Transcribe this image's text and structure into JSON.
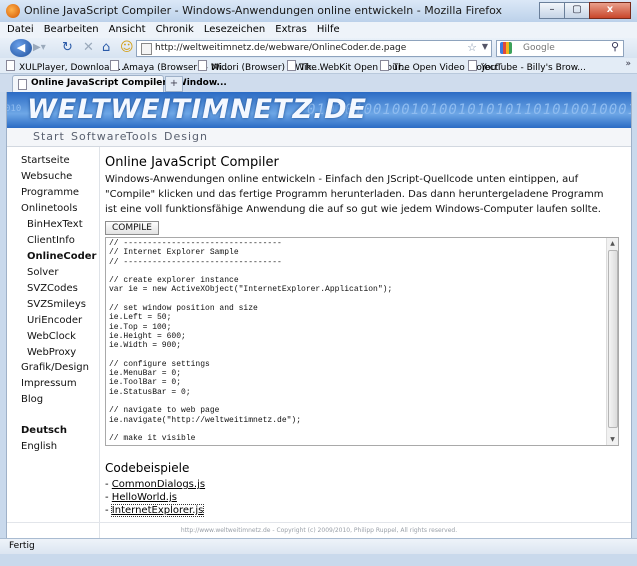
{
  "window": {
    "title": "Online JavaScript Compiler - Windows-Anwendungen online entwickeln - Mozilla Firefox",
    "controls": [
      "–",
      "▢",
      "x"
    ]
  },
  "menu": [
    "Datei",
    "Bearbeiten",
    "Ansicht",
    "Chronik",
    "Lesezeichen",
    "Extras",
    "Hilfe"
  ],
  "navigation": {
    "url": "http://weltweitimnetz.de/webware/OnlineCoder.de.page",
    "search_placeholder": "Google"
  },
  "bookmarks": [
    "XULPlayer, Download ...",
    "Amaya (Browser) – Wi...",
    "Midori (Browser) – Wik...",
    "The WebKit Open Sour...",
    "The Open Video Project",
    "YouTube - Billy's Brow..."
  ],
  "bookmarks_more": "»",
  "tab": {
    "label": "Online JavaScript Compiler - Window...",
    "new_tab": "+"
  },
  "site": {
    "logo": "WELTWEITIMNETZ.DE",
    "binary_pattern": "01010100100101001010101101010010001011100",
    "binary_left": "010",
    "topnav": [
      "Start",
      "Software",
      "Tools",
      "Design"
    ],
    "sidebar": [
      "Startseite",
      "Websuche",
      "Programme",
      "Onlinetools",
      "BinHexText",
      "ClientInfo",
      "OnlineCoder",
      "Solver",
      "SVZCodes",
      "SVZSmileys",
      "UriEncoder",
      "WebClock",
      "WebProxy",
      "Grafik/Design",
      "Impressum",
      "Blog",
      "Deutsch",
      "English"
    ],
    "heading": "Online JavaScript Compiler",
    "description": "Windows-Anwendungen online entwickeln - Einfach den JScript-Quellcode unten eintippen, auf \"Compile\" klicken und das fertige Programm herunterladen. Das dann heruntergeladene Programm ist eine voll funktionsfähige Anwendung die auf so gut wie jedem Windows-Computer laufen sollte.",
    "compile_button": "COMPILE",
    "code": "// ---------------------------------\n// Internet Explorer Sample\n// ---------------------------------\n\n// create explorer instance\nvar ie = new ActiveXObject(\"InternetExplorer.Application\");\n\n// set window position and size\nie.Left = 50;\nie.Top = 100;\nie.Height = 600;\nie.Width = 900;\n\n// configure settings\nie.MenuBar = 0;\nie.ToolBar = 0;\nie.StatusBar = 0;\n\n// navigate to web page\nie.navigate(\"http://weltweitimnetz.de\");\n\n// make it visible",
    "examples_heading": "Codebeispiele",
    "examples": [
      "CommonDialogs.js",
      "HelloWorld.js",
      "InternetExplorer.js"
    ],
    "link_prefix": "- ",
    "footer": "http://www.weltweitimnetz.de - Copyright (c) 2009/2010, Philipp Ruppel, All rights reserved."
  },
  "status": "Fertig"
}
